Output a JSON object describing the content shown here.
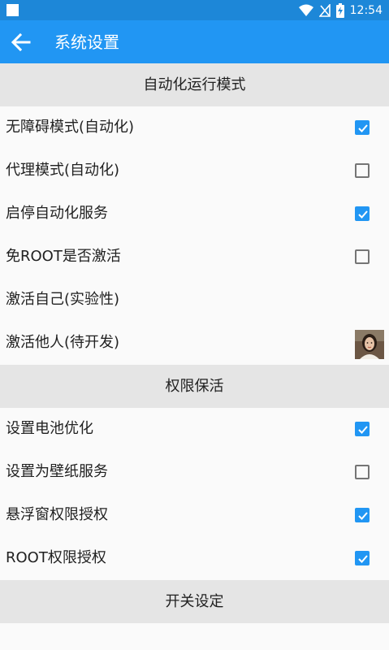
{
  "status_bar": {
    "time": "12:54",
    "icons": [
      "notification-square-icon",
      "wifi-icon",
      "no-signal-icon",
      "battery-charging-icon"
    ]
  },
  "app_bar": {
    "title": "系统设置",
    "back_icon": "arrow-left-icon"
  },
  "colors": {
    "status_bar": "#1d87d8",
    "app_bar": "#2196f3",
    "checkbox_checked": "#2196f3",
    "section_background": "#e5e5e5"
  },
  "sections": [
    {
      "title": "自动化运行模式",
      "items": [
        {
          "label": "无障碍模式(自动化)",
          "control": "checkbox",
          "checked": true
        },
        {
          "label": "代理模式(自动化)",
          "control": "checkbox",
          "checked": false
        },
        {
          "label": "启停自动化服务",
          "control": "checkbox",
          "checked": true
        },
        {
          "label": "免ROOT是否激活",
          "control": "checkbox",
          "checked": false
        },
        {
          "label": "激活自己(实验性)",
          "control": "none"
        },
        {
          "label": "激活他人(待开发)",
          "control": "avatar"
        }
      ]
    },
    {
      "title": "权限保活",
      "items": [
        {
          "label": "设置电池优化",
          "control": "checkbox",
          "checked": true
        },
        {
          "label": "设置为壁纸服务",
          "control": "checkbox",
          "checked": false
        },
        {
          "label": "悬浮窗权限授权",
          "control": "checkbox",
          "checked": true
        },
        {
          "label": "ROOT权限授权",
          "control": "checkbox",
          "checked": true
        }
      ]
    },
    {
      "title": "开关设定",
      "items": []
    }
  ]
}
